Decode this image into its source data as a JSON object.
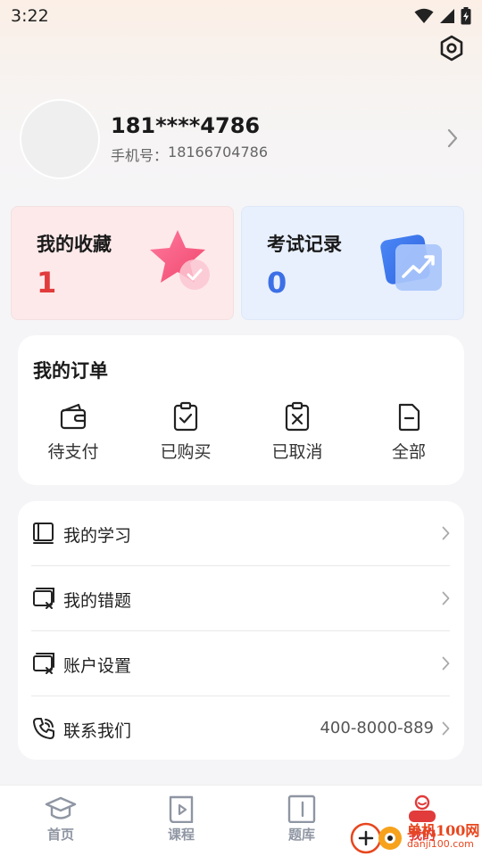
{
  "status_bar": {
    "time": "3:22",
    "icons": [
      "wifi-icon",
      "signal-icon",
      "battery-charging-icon"
    ]
  },
  "header": {
    "settings_icon": "settings-gear-icon"
  },
  "profile": {
    "username": "181****4786",
    "phone_label": "手机号：",
    "phone_value": "18166704786"
  },
  "cards": {
    "favorites": {
      "title": "我的收藏",
      "value": "1",
      "color": "#e23b3b"
    },
    "exam_records": {
      "title": "考试记录",
      "value": "0",
      "color": "#3d6fe6"
    }
  },
  "orders": {
    "title": "我的订单",
    "items": [
      {
        "label": "待支付",
        "icon": "wallet-icon"
      },
      {
        "label": "已购买",
        "icon": "clipboard-check-icon"
      },
      {
        "label": "已取消",
        "icon": "clipboard-x-icon"
      },
      {
        "label": "全部",
        "icon": "document-icon"
      }
    ]
  },
  "menu": {
    "items": [
      {
        "label": "我的学习",
        "icon": "book-icon",
        "value": ""
      },
      {
        "label": "我的错题",
        "icon": "mistake-card-icon",
        "value": ""
      },
      {
        "label": "账户设置",
        "icon": "account-card-icon",
        "value": ""
      },
      {
        "label": "联系我们",
        "icon": "phone-icon",
        "value": "400-8000-889"
      }
    ]
  },
  "tab_bar": {
    "tabs": [
      {
        "label": "首页",
        "icon": "graduation-cap-icon",
        "active": false
      },
      {
        "label": "课程",
        "icon": "video-book-icon",
        "active": false
      },
      {
        "label": "题库",
        "icon": "question-book-icon",
        "active": false
      },
      {
        "label": "我的",
        "icon": "user-icon",
        "active": true
      }
    ],
    "active_color": "#e23b3b",
    "inactive_color": "#8f96a3"
  },
  "watermark": {
    "text": "单机100网",
    "url": "danji100.com"
  }
}
